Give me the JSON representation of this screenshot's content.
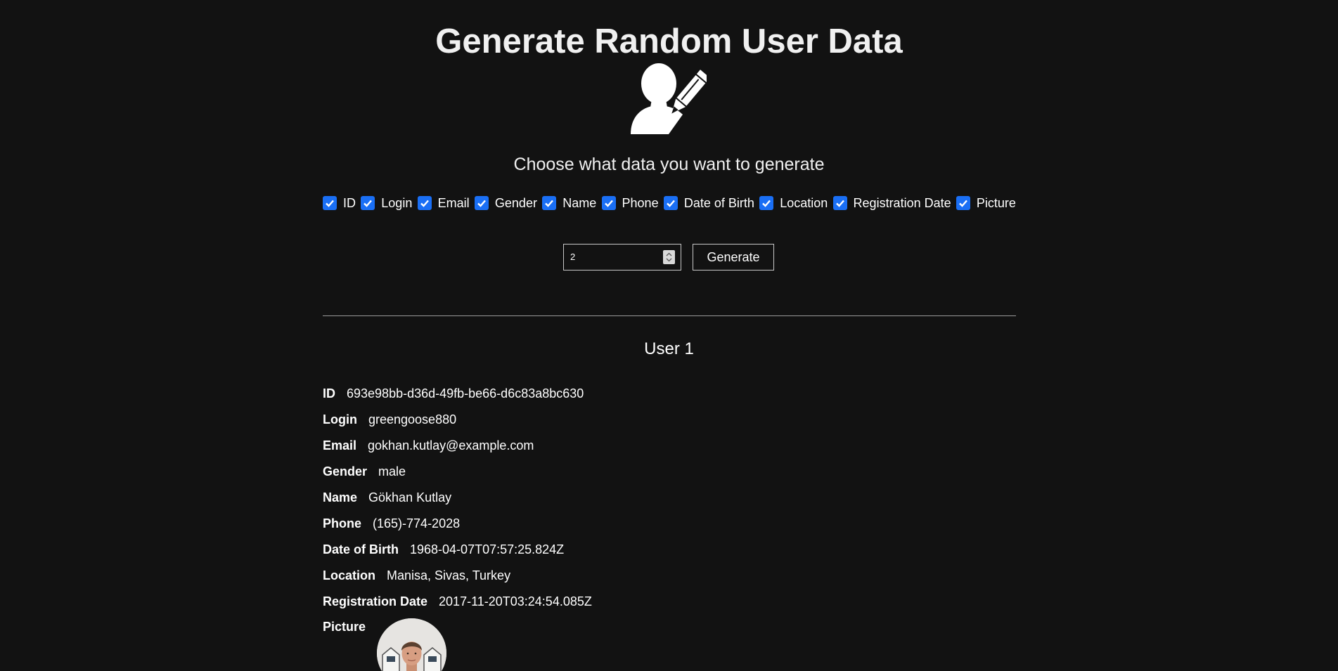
{
  "page": {
    "title": "Generate Random User Data",
    "subtitle": "Choose what data you want to generate"
  },
  "options": [
    {
      "label": "ID",
      "checked": true
    },
    {
      "label": "Login",
      "checked": true
    },
    {
      "label": "Email",
      "checked": true
    },
    {
      "label": "Gender",
      "checked": true
    },
    {
      "label": "Name",
      "checked": true
    },
    {
      "label": "Phone",
      "checked": true
    },
    {
      "label": "Date of Birth",
      "checked": true
    },
    {
      "label": "Location",
      "checked": true
    },
    {
      "label": "Registration Date",
      "checked": true
    },
    {
      "label": "Picture",
      "checked": true
    }
  ],
  "controls": {
    "count_value": "2",
    "generate_label": "Generate"
  },
  "user": {
    "heading": "User 1",
    "fields": [
      {
        "label": "ID",
        "value": "693e98bb-d36d-49fb-be66-d6c83a8bc630"
      },
      {
        "label": "Login",
        "value": "greengoose880"
      },
      {
        "label": "Email",
        "value": "gokhan.kutlay@example.com"
      },
      {
        "label": "Gender",
        "value": "male"
      },
      {
        "label": "Name",
        "value": "Gökhan Kutlay"
      },
      {
        "label": "Phone",
        "value": "(165)-774-2028"
      },
      {
        "label": "Date of Birth",
        "value": "1968-04-07T07:57:25.824Z"
      },
      {
        "label": "Location",
        "value": "Manisa, Sivas, Turkey"
      },
      {
        "label": "Registration Date",
        "value": "2017-11-20T03:24:54.085Z"
      }
    ],
    "picture_label": "Picture"
  },
  "colors": {
    "background": "#121212",
    "checkbox_accent": "#1a6ff5",
    "text": "#ffffff"
  },
  "icons": {
    "hero": "user-edit-icon",
    "checkbox": "checkmark-icon",
    "spinner": "spinner-arrows-icon",
    "avatar": "user-avatar-photo"
  }
}
